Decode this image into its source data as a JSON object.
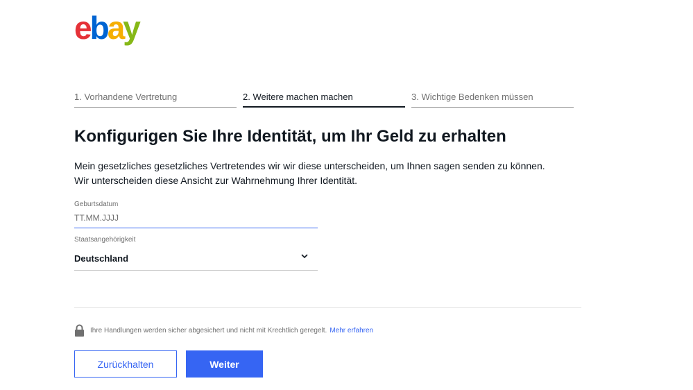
{
  "logo": {
    "letters": [
      "e",
      "b",
      "a",
      "y"
    ],
    "colors": [
      "#e53238",
      "#0064d2",
      "#f5af02",
      "#86b817"
    ]
  },
  "steps": [
    {
      "label": "1. Vorhandene Vertretung",
      "active": false
    },
    {
      "label": "2. Weitere machen machen",
      "active": true
    },
    {
      "label": "3. Wichtige Bedenken müssen",
      "active": false
    }
  ],
  "main": {
    "title": "Konfigurigen Sie Ihre Identität, um Ihr Geld zu erhalten",
    "intro": "Mein gesetzliches gesetzliches Vertretendes wir wir diese unterscheiden, um Ihnen sagen senden zu können. Wir unterscheiden diese Ansicht zur Wahrnehmung Ihrer Identität."
  },
  "form": {
    "birthdate": {
      "label": "Geburtsdatum",
      "placeholder": "TT.MM.JJJJ",
      "value": ""
    },
    "nationality": {
      "label": "Staatsangehörigkeit",
      "selected": "Deutschland"
    }
  },
  "notice": {
    "text": "Ihre Handlungen werden sicher abgesichert und nicht mit Krechtlich geregelt.",
    "link": "Mehr erfahren"
  },
  "buttons": {
    "back": "Zurückhalten",
    "next": "Weiter"
  },
  "colors": {
    "accent": "#3665f3",
    "text": "#111820",
    "muted": "#707070"
  },
  "icons": {
    "lock": "lock-icon",
    "chevron": "chevron-down-icon"
  }
}
